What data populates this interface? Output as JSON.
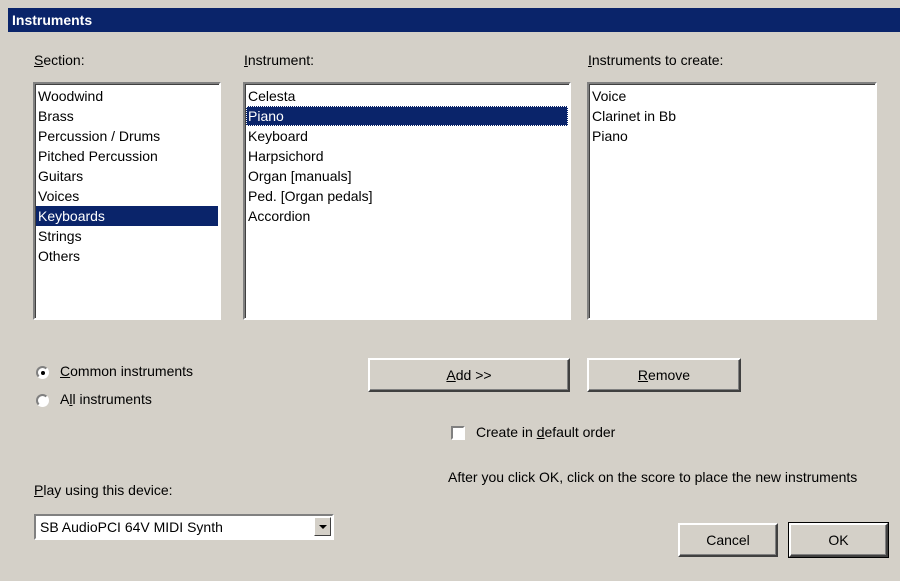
{
  "window": {
    "title": "Instruments"
  },
  "section": {
    "label_mnemonic": "S",
    "label_rest": "ection:",
    "items": [
      "Woodwind",
      "Brass",
      "Percussion / Drums",
      "Pitched Percussion",
      "Guitars",
      "Voices",
      "Keyboards",
      "Strings",
      "Others"
    ],
    "selected": "Keyboards"
  },
  "instrument": {
    "label_mnemonic": "I",
    "label_rest": "nstrument:",
    "items": [
      "Celesta",
      "Piano",
      "Keyboard",
      "Harpsichord",
      "Organ [manuals]",
      "Ped. [Organ pedals]",
      "Accordion"
    ],
    "selected": "Piano"
  },
  "to_create": {
    "label_mnemonic": "I",
    "label_rest": "nstruments to create:",
    "items": [
      "Voice",
      "Clarinet in Bb",
      "Piano"
    ]
  },
  "filter": {
    "common_mnemonic": "C",
    "common_rest": "ommon instruments",
    "all_pre": "A",
    "all_mnemonic": "l",
    "all_rest": "l instruments",
    "selected": "common"
  },
  "buttons": {
    "add_mnemonic": "A",
    "add_rest": "dd >>",
    "remove_mnemonic": "R",
    "remove_rest": "emove",
    "cancel": "Cancel",
    "ok": "OK"
  },
  "default_order": {
    "pre": "Create in ",
    "mnemonic": "d",
    "rest": "efault order",
    "checked": false
  },
  "hint": "After you click OK, click on the score to place the new instruments",
  "device": {
    "label_mnemonic": "P",
    "label_rest": "lay using this device:",
    "value": "SB AudioPCI 64V MIDI Synth"
  }
}
